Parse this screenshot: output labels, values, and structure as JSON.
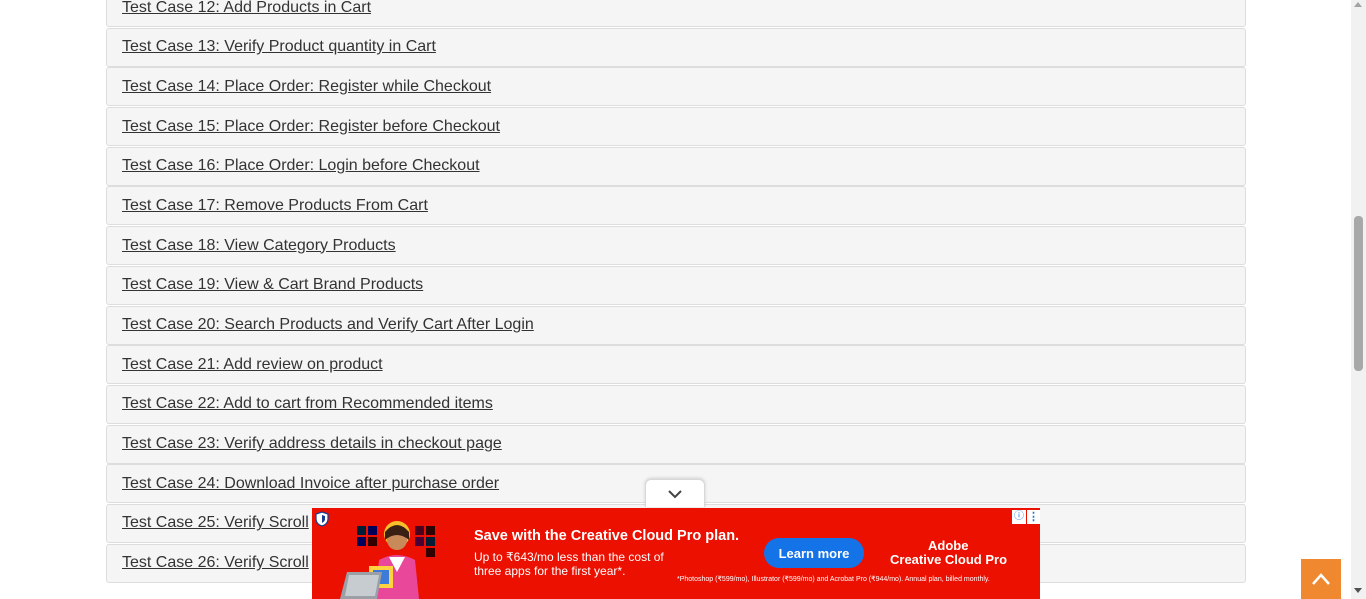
{
  "test_cases": [
    "Test Case 12: Add Products in Cart",
    "Test Case 13: Verify Product quantity in Cart",
    "Test Case 14: Place Order: Register while Checkout",
    "Test Case 15: Place Order: Register before Checkout",
    "Test Case 16: Place Order: Login before Checkout",
    "Test Case 17: Remove Products From Cart",
    "Test Case 18: View Category Products",
    "Test Case 19: View & Cart Brand Products",
    "Test Case 20: Search Products and Verify Cart After Login",
    "Test Case 21: Add review on product",
    "Test Case 22: Add to cart from Recommended items",
    "Test Case 23: Verify address details in checkout page",
    "Test Case 24: Download Invoice after purchase order",
    "Test Case 25: Verify Scroll",
    "Test Case 26: Verify Scroll"
  ],
  "ad": {
    "headline": "Save with the Creative Cloud Pro plan.",
    "subtext": "Up to ₹643/mo less than the cost of three apps for the first year*.",
    "cta": "Learn more",
    "brand_top": "Adobe",
    "brand": "Creative Cloud Pro",
    "fine_print": "*Photoshop (₹599/mo), Illustrator (₹599/mo) and Acrobat Pro (₹944/mo). Annual plan, billed monthly.",
    "info_glyph": "ⓘ",
    "menu_glyph": "⋮",
    "background_color": "#eb1000",
    "cta_color": "#1473e6"
  },
  "scroll_top_color": "#f0882f",
  "icons": {
    "scroll_top": "chevron-up-icon",
    "collapse": "chevron-down-icon",
    "shield": "shield-icon"
  }
}
